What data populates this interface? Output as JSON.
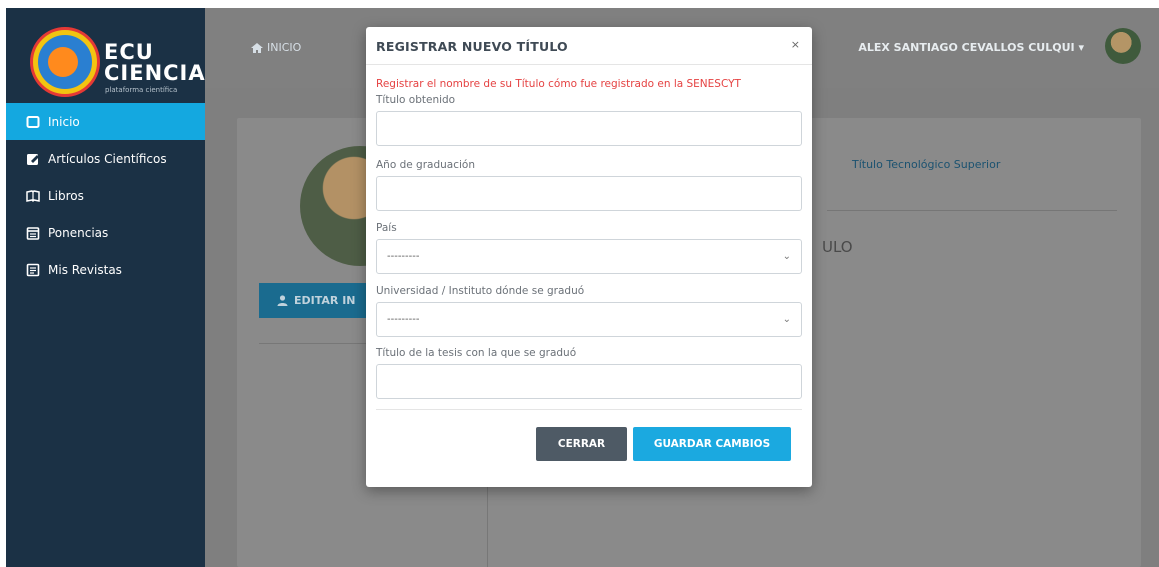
{
  "brand": {
    "line1": "ECU",
    "line2": "CIENCIA",
    "tagline": "plataforma científica"
  },
  "sidebar": {
    "items": [
      {
        "label": "Inicio",
        "icon": "square-icon",
        "active": true
      },
      {
        "label": "Artículos Científicos",
        "icon": "edit-icon",
        "active": false
      },
      {
        "label": "Libros",
        "icon": "book-icon",
        "active": false
      },
      {
        "label": "Ponencias",
        "icon": "calendar-icon",
        "active": false
      },
      {
        "label": "Mis Revistas",
        "icon": "document-icon",
        "active": false
      }
    ]
  },
  "topbar": {
    "home_label": "INICIO",
    "user_name": "ALEX SANTIAGO CEVALLOS CULQUI"
  },
  "background": {
    "edit_button": "EDITAR IN",
    "title_type": "Título Tecnológico Superior",
    "partial_text": "ULO"
  },
  "modal": {
    "title": "REGISTRAR NUEVO TÍTULO",
    "close_symbol": "×",
    "intro": "Registrar el nombre de su Título cómo fue registrado en la SENESCYT",
    "fields": {
      "titulo": {
        "label": "Título obtenido",
        "value": ""
      },
      "anio": {
        "label": "Año de graduación",
        "value": ""
      },
      "pais": {
        "label": "País",
        "value": "---------"
      },
      "universidad": {
        "label": "Universidad / Instituto dónde se graduó",
        "value": "---------"
      },
      "tesis": {
        "label": "Título de la tesis con la que se graduó",
        "value": ""
      }
    },
    "buttons": {
      "close": "CERRAR",
      "save": "GUARDAR CAMBIOS"
    }
  },
  "colors": {
    "sidebar_bg": "#1b3145",
    "accent": "#14a8e0",
    "error_text": "#e54242",
    "close_button": "#4e5a65"
  }
}
